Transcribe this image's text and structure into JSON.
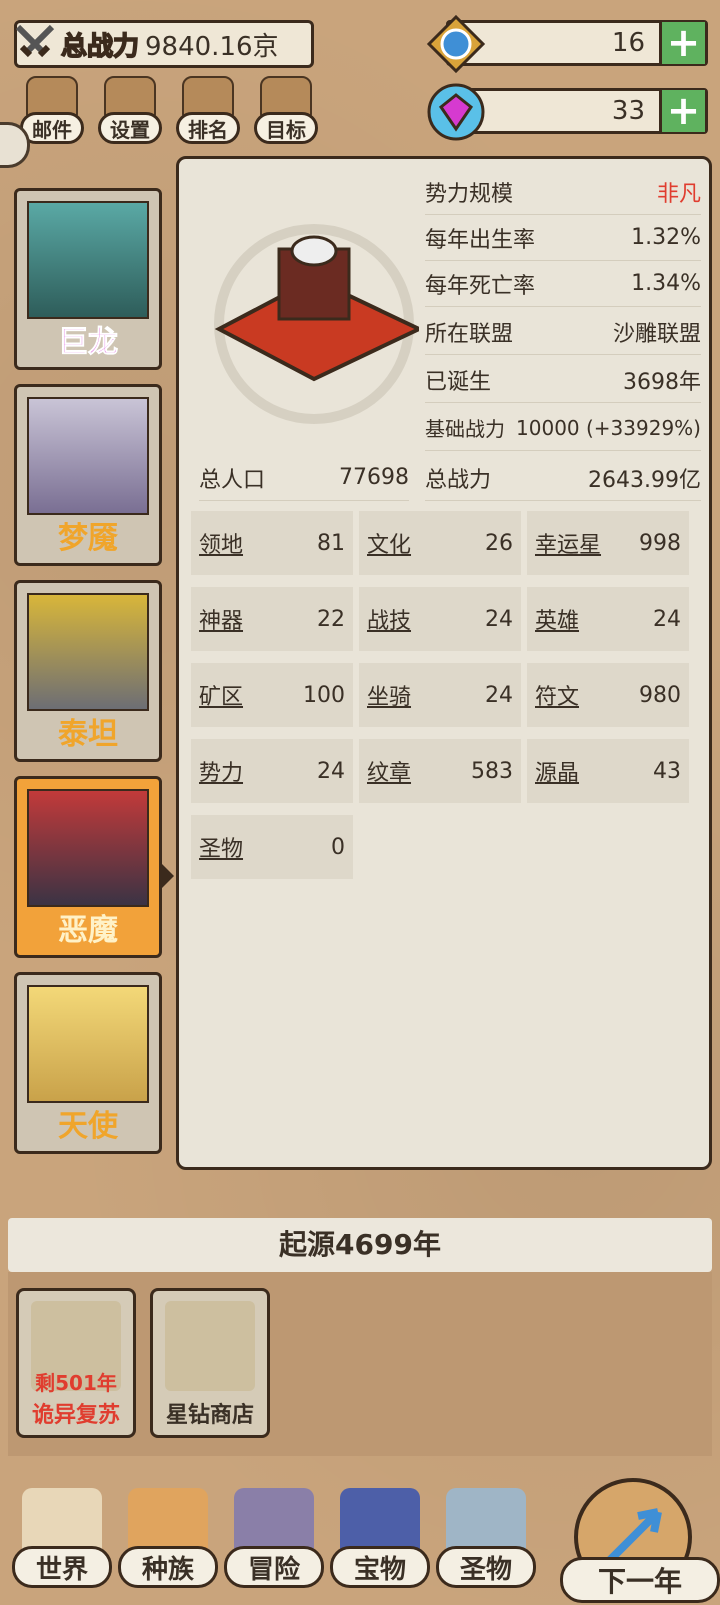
{
  "header": {
    "power_label": "总战力",
    "power_value": "9840.16京",
    "resource1_value": "16",
    "resource2_value": "33",
    "plus_label": "+"
  },
  "menu": [
    {
      "label": "邮件",
      "icon": "mail-icon"
    },
    {
      "label": "设置",
      "icon": "gear-icon"
    },
    {
      "label": "排名",
      "icon": "ranking-icon"
    },
    {
      "label": "目标",
      "icon": "scroll-icon"
    }
  ],
  "races": [
    {
      "name": "巨龙",
      "color": "#d43ad6"
    },
    {
      "name": "梦魇",
      "color": "#f0a52b"
    },
    {
      "name": "泰坦",
      "color": "#f0a52b"
    },
    {
      "name": "恶魔",
      "color": "#f0a52b"
    },
    {
      "name": "天使",
      "color": "#f0a52b"
    }
  ],
  "info": [
    {
      "label": "势力规模",
      "value": "非凡"
    },
    {
      "label": "每年出生率",
      "value": "1.32%"
    },
    {
      "label": "每年死亡率",
      "value": "1.34%"
    },
    {
      "label": "所在联盟",
      "value": "沙雕联盟"
    },
    {
      "label": "已诞生",
      "value": "3698年"
    },
    {
      "label": "基础战力",
      "value": "10000 (+33929%)"
    },
    {
      "label": "总战力",
      "value": "2643.99亿"
    }
  ],
  "population": {
    "label": "总人口",
    "value": "77698"
  },
  "stats": [
    {
      "label": "领地",
      "value": "81"
    },
    {
      "label": "文化",
      "value": "26"
    },
    {
      "label": "幸运星",
      "value": "998"
    },
    {
      "label": "神器",
      "value": "22"
    },
    {
      "label": "战技",
      "value": "24"
    },
    {
      "label": "英雄",
      "value": "24"
    },
    {
      "label": "矿区",
      "value": "100"
    },
    {
      "label": "坐骑",
      "value": "24"
    },
    {
      "label": "符文",
      "value": "980"
    },
    {
      "label": "势力",
      "value": "24"
    },
    {
      "label": "纹章",
      "value": "583"
    },
    {
      "label": "源晶",
      "value": "43"
    },
    {
      "label": "圣物",
      "value": "0"
    }
  ],
  "origin": "起源4699年",
  "buildings": [
    {
      "countdown": "剩501年",
      "label": "诡异复苏"
    },
    {
      "label": "星钻商店"
    }
  ],
  "nav": [
    {
      "label": "世界"
    },
    {
      "label": "种族"
    },
    {
      "label": "冒险"
    },
    {
      "label": "宝物"
    },
    {
      "label": "圣物"
    }
  ],
  "next_label": "下一年",
  "colors": {
    "accent_red": "#e03d2f",
    "plus_green": "#5fb25f",
    "active_tab": "#f2a23a"
  }
}
